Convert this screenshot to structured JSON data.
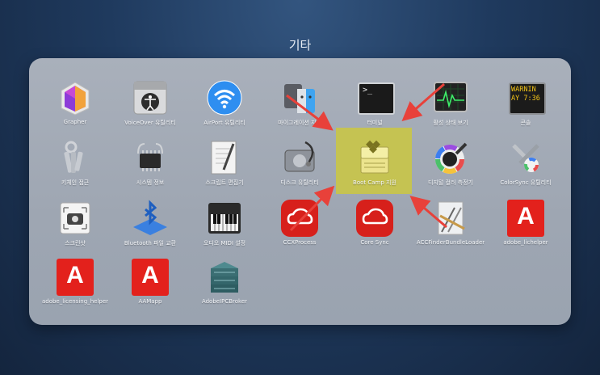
{
  "folder": {
    "title": "기타"
  },
  "apps": [
    {
      "key": "grapher",
      "label": "Grapher"
    },
    {
      "key": "voiceover",
      "label": "VoiceOver 유틸리티"
    },
    {
      "key": "airport",
      "label": "AirPort 유틸리티"
    },
    {
      "key": "migration",
      "label": "마이그레이션 지원"
    },
    {
      "key": "terminal",
      "label": "터미널"
    },
    {
      "key": "activity",
      "label": "활성 상태 보기"
    },
    {
      "key": "console",
      "label": "콘솔",
      "screen_text": [
        "WARNIN",
        "AY 7:36"
      ]
    },
    {
      "key": "keychain",
      "label": "키체인 접근"
    },
    {
      "key": "sysinfo",
      "label": "시스템 정보"
    },
    {
      "key": "script",
      "label": "스크립트 편집기"
    },
    {
      "key": "disk",
      "label": "디스크 유틸리티"
    },
    {
      "key": "bootcamp",
      "label": "Boot Camp 지원"
    },
    {
      "key": "colormeter",
      "label": "디지털 컬러 측정기"
    },
    {
      "key": "colorsync",
      "label": "ColorSync 유틸리티"
    },
    {
      "key": "screenshot",
      "label": "스크린샷"
    },
    {
      "key": "bluetooth",
      "label": "Bluetooth 파일 교환"
    },
    {
      "key": "midi",
      "label": "오디오 MIDI 설정"
    },
    {
      "key": "ccx",
      "label": "CCXProcess"
    },
    {
      "key": "coresync",
      "label": "Core Sync"
    },
    {
      "key": "acc",
      "label": "ACCFinderBundleLoader"
    },
    {
      "key": "lichelper",
      "label": "adobe_licensing_helper"
    },
    {
      "key": "lichelper2",
      "label": "adobe_lichelper"
    },
    {
      "key": "aasl",
      "label": "AAMapp"
    },
    {
      "key": "ipc",
      "label": "AdobeIPCBroker"
    }
  ],
  "terminal_prompt": ">_",
  "adobe_letter": "A",
  "selected_app": "Boot Camp 지원",
  "colors": {
    "highlight": "#c9c547",
    "arrow": "#e8413a",
    "adobe_red": "#e3211c"
  }
}
